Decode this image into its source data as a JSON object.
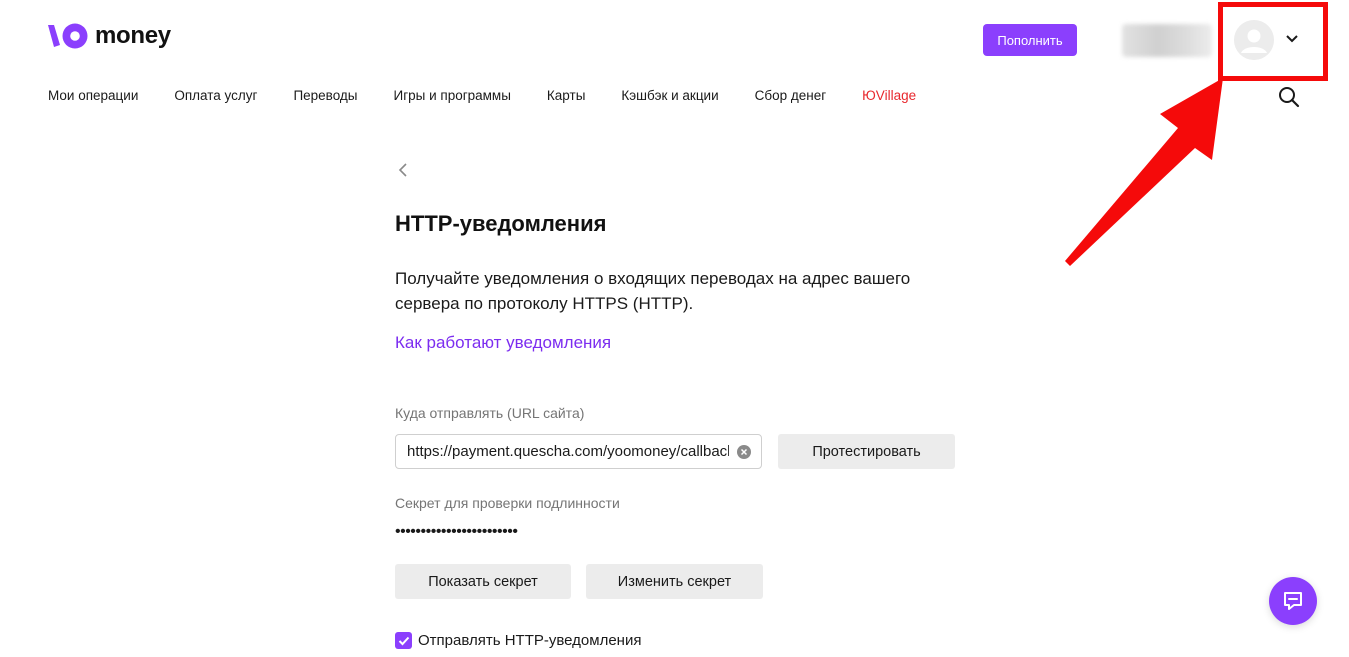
{
  "header": {
    "logo_text": "money",
    "logo_icon": "yoomoney-logo-icon",
    "topup_label": "Пополнить",
    "avatar_icon": "user-avatar-icon",
    "menu_icon": "chevron-down-icon"
  },
  "nav": {
    "items": [
      {
        "label": "Мои операции"
      },
      {
        "label": "Оплата услуг"
      },
      {
        "label": "Переводы"
      },
      {
        "label": "Игры и программы"
      },
      {
        "label": "Карты"
      },
      {
        "label": "Кэшбэк и акции"
      },
      {
        "label": "Сбор денег"
      },
      {
        "label": "ЮVillage"
      }
    ],
    "search_icon": "search-icon"
  },
  "main": {
    "back_icon": "chevron-left-icon",
    "title": "HTTP-уведомления",
    "description": "Получайте уведомления о входящих переводах на адрес вашего сервера по протоколу HTTPS (HTTP).",
    "how_link": "Как работают уведомления",
    "url_label": "Куда отправлять (URL сайта)",
    "url_value": "https://payment.quescha.com/yoomoney/callback",
    "test_button": "Протестировать",
    "secret_label": "Секрет для проверки подлинности",
    "secret_masked": "••••••••••••••••••••••••",
    "show_secret_button": "Показать секрет",
    "change_secret_button": "Изменить секрет",
    "send_checkbox_label": "Отправлять HTTP-уведомления",
    "send_checkbox_checked": true
  },
  "chat": {
    "icon": "chat-icon"
  },
  "colors": {
    "brand_purple": "#8b3ffd",
    "link_purple": "#7c2df0",
    "accent_red": "#e8272d",
    "annotation_red": "#f50a0a"
  }
}
